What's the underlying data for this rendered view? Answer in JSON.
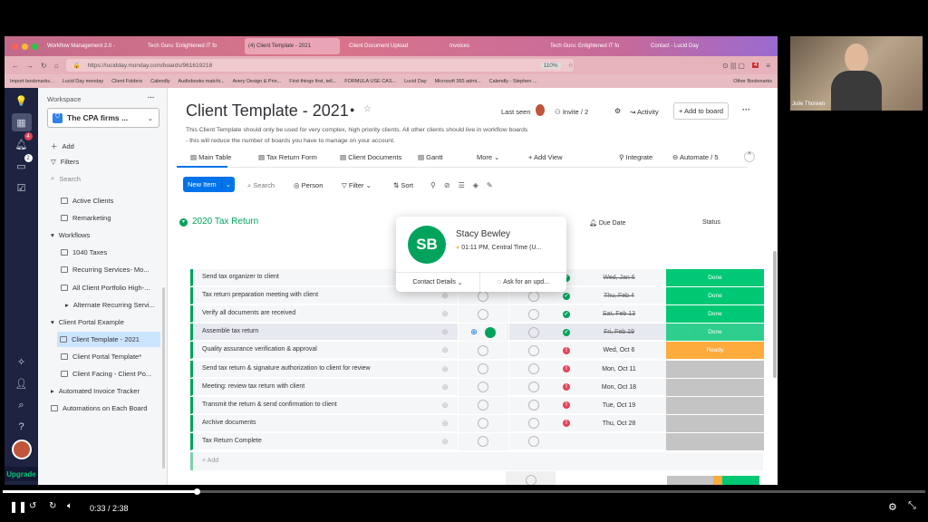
{
  "browser": {
    "tabs": [
      "Workflow Management 2.0 -",
      "Tech Guru: Enlightened IT fo",
      "(4) Client Template - 2021",
      "Client Document Upload",
      "Invoices",
      "Tech Guru: Enlightened IT fo",
      "Contact - Lucid Day"
    ],
    "url": "https://lucidday.monday.com/boards/961619218",
    "zoom": "110%",
    "ext_badge": "4",
    "bookmarks": [
      "Import bookmarks...",
      "Lucid Day monday",
      "Client Folders",
      "Calendly",
      "Audiobooks matchi...",
      "Avery Design & Prin...",
      "First things first, tell...",
      "FORMULA USE CAS...",
      "Lucid Day",
      "Microsoft 365 admi...",
      "Calendly - Stephen ...",
      "Other Bookmarks"
    ]
  },
  "leftnav": {
    "notif_badge": "4",
    "inbox_badge": "2",
    "upgrade": "Upgrade"
  },
  "sidebar": {
    "workspace_label": "Workspace",
    "workspace": "The CPA firms ...",
    "add": "Add",
    "filters": "Filters",
    "search": "Search",
    "items": [
      "Active Clients",
      "Remarketing",
      "Workflows",
      "1040 Taxes",
      "Recurring Services- Mo...",
      "All Client Portfolio High-...",
      "Alternate Recurring Servi...",
      "Client Portal Example",
      "Client Template - 2021",
      "Client Portal Template*",
      "Client Facing - Client Po...",
      "Automated Invoice Tracker",
      "Automations on Each Board"
    ]
  },
  "board": {
    "title": "Client Template - 2021",
    "description1": "This Client Template should only be used for very complex, high priority clients. All other clients should live in workflow boards",
    "description2": "- this will reduce the number of boards you have to manage on your account.",
    "last_seen": "Last seen",
    "invite": "Invite / 2",
    "activity": "Activity",
    "add_to_board": "+ Add to board",
    "views": [
      "Main Table",
      "Tax Return Form",
      "Client Documents",
      "Gantt",
      "More",
      "+ Add View"
    ],
    "integrate": "Integrate",
    "automate": "Automate / 5",
    "toolbar": {
      "new_item": "New Item",
      "search": "Search",
      "person": "Person",
      "filter": "Filter",
      "sort": "Sort"
    },
    "group": {
      "title": "2020 Tax Return",
      "color": "#00a35c"
    },
    "columns": {
      "due_date": "Due Date",
      "status": "Status"
    },
    "rows": [
      {
        "name": "Send tax organizer to client",
        "date": "Wed, Jan 6",
        "status": "Done",
        "done": true
      },
      {
        "name": "Tax return preparation meeting with client",
        "date": "Thu, Feb 4",
        "status": "Done",
        "done": true
      },
      {
        "name": "Verify all documents are received",
        "date": "Sat, Feb 13",
        "status": "Done",
        "done": true
      },
      {
        "name": "Assemble tax return",
        "date": "Fri, Feb 19",
        "status": "Done",
        "done": true
      },
      {
        "name": "Quality assurance verification & approval",
        "date": "Wed, Oct 6",
        "status": "Ready",
        "done": false
      },
      {
        "name": "Send tax return & signature authorization to client for review",
        "date": "Mon, Oct 11",
        "status": "",
        "done": false
      },
      {
        "name": "Meeting: review tax return with client",
        "date": "Mon, Oct 18",
        "status": "",
        "done": false
      },
      {
        "name": "Transmit the return & send confirmation to client",
        "date": "Tue, Oct 19",
        "status": "",
        "done": false
      },
      {
        "name": "Archive documents",
        "date": "Thu, Oct 28",
        "status": "",
        "done": false
      },
      {
        "name": "Tax Return Complete",
        "date": "",
        "status": "",
        "done": false
      }
    ],
    "add_row": "+ Add",
    "status_colors": {
      "Done": "#00c875",
      "Ready": "#fdab3d",
      "empty": "#c4c4c4"
    },
    "status_summary": [
      {
        "status": "empty",
        "percent": 50
      },
      {
        "status": "Ready",
        "percent": 10
      },
      {
        "status": "Done",
        "percent": 40
      }
    ]
  },
  "popup": {
    "initials": "SB",
    "name": "Stacy Bewley",
    "time": "01:11 PM, Central Time (U...",
    "contact": "Contact Details",
    "ask": "Ask for an upd..."
  },
  "webcam": {
    "name": "Julie Thoreen"
  },
  "player": {
    "current": "0:33",
    "duration": "2:38",
    "progress_percent": 21
  }
}
